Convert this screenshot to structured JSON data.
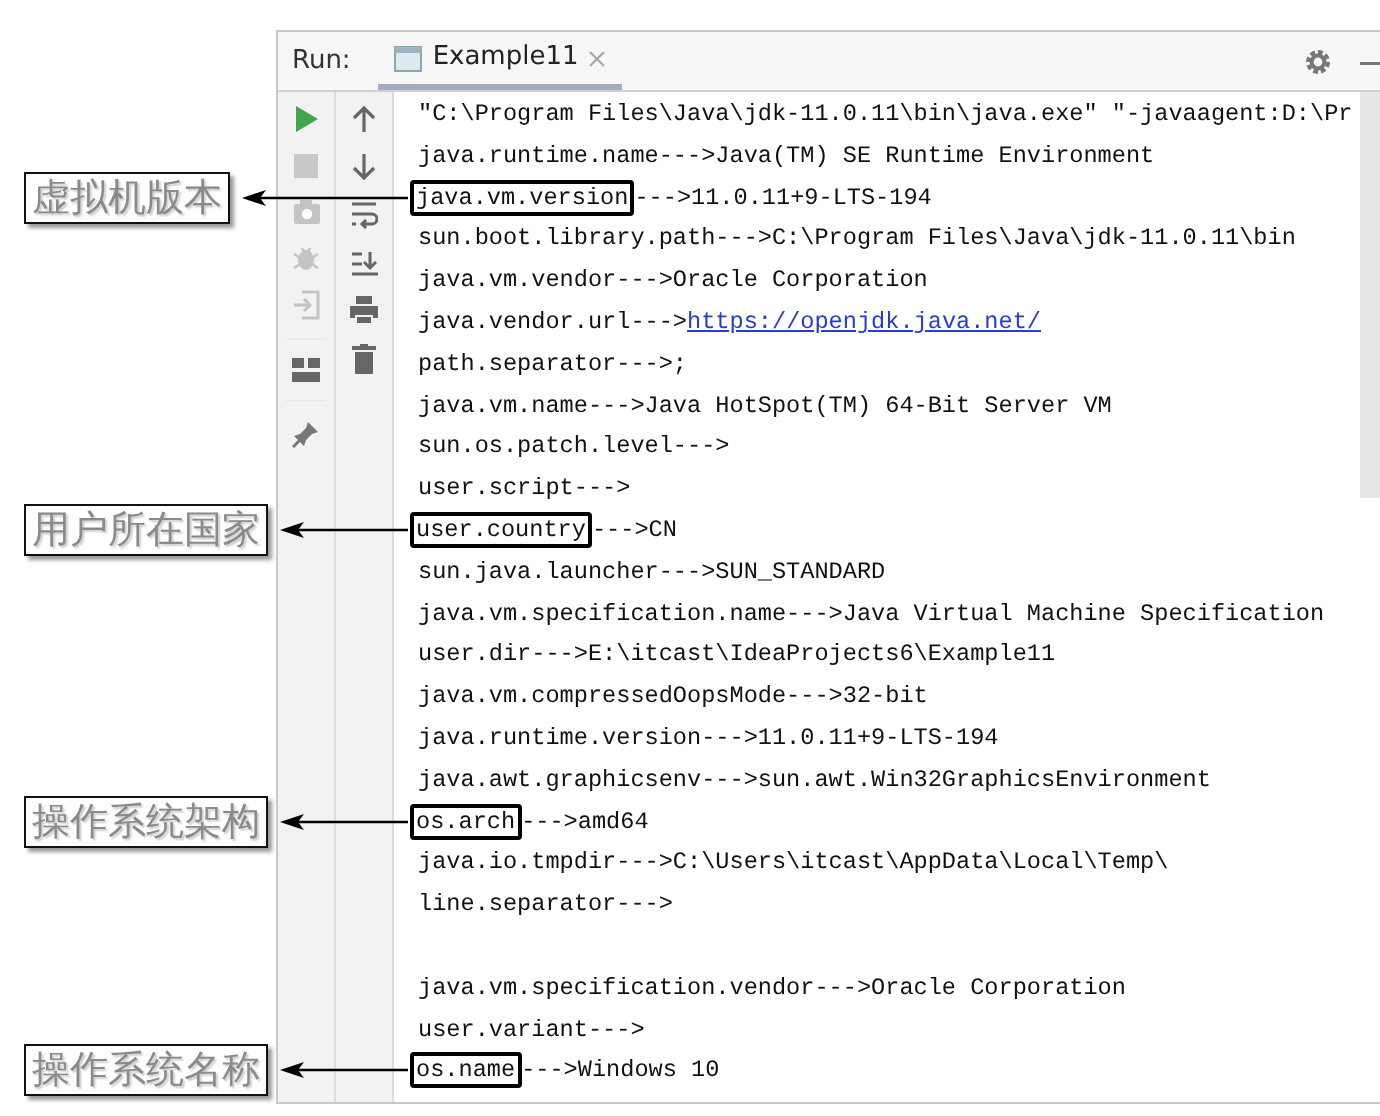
{
  "run_panel": {
    "label": "Run:",
    "tabs": [
      {
        "title": "Example11",
        "selected": true
      }
    ]
  },
  "console": {
    "lines": [
      {
        "kind": "plain",
        "text": "\"C:\\Program Files\\Java\\jdk-11.0.11\\bin\\java.exe\" \"-javaagent:D:\\Pr"
      },
      {
        "kind": "plain",
        "text": "java.runtime.name--->Java(TM) SE Runtime Environment"
      },
      {
        "kind": "boxed",
        "key": "java.vm.version",
        "text": "--->11.0.11+9-LTS-194",
        "callout": "虚拟机版本"
      },
      {
        "kind": "plain",
        "text": "sun.boot.library.path--->C:\\Program Files\\Java\\jdk-11.0.11\\bin"
      },
      {
        "kind": "plain",
        "text": "java.vm.vendor--->Oracle Corporation"
      },
      {
        "kind": "link",
        "text": "java.vendor.url--->",
        "link": "https://openjdk.java.net/"
      },
      {
        "kind": "plain",
        "text": "path.separator--->;"
      },
      {
        "kind": "plain",
        "text": "java.vm.name--->Java HotSpot(TM) 64-Bit Server VM"
      },
      {
        "kind": "plain",
        "text": "sun.os.patch.level--->"
      },
      {
        "kind": "plain",
        "text": "user.script--->"
      },
      {
        "kind": "boxed",
        "key": "user.country",
        "text": "--->CN",
        "callout": "用户所在国家"
      },
      {
        "kind": "plain",
        "text": "sun.java.launcher--->SUN_STANDARD"
      },
      {
        "kind": "plain",
        "text": "java.vm.specification.name--->Java Virtual Machine Specification"
      },
      {
        "kind": "plain",
        "text": "user.dir--->E:\\itcast\\IdeaProjects6\\Example11"
      },
      {
        "kind": "plain",
        "text": "java.vm.compressedOopsMode--->32-bit"
      },
      {
        "kind": "plain",
        "text": "java.runtime.version--->11.0.11+9-LTS-194"
      },
      {
        "kind": "plain",
        "text": "java.awt.graphicsenv--->sun.awt.Win32GraphicsEnvironment"
      },
      {
        "kind": "boxed",
        "key": "os.arch",
        "text": "--->amd64",
        "callout": "操作系统架构"
      },
      {
        "kind": "plain",
        "text": "java.io.tmpdir--->C:\\Users\\itcast\\AppData\\Local\\Temp\\"
      },
      {
        "kind": "plain",
        "text": "line.separator--->"
      },
      {
        "kind": "blank"
      },
      {
        "kind": "plain",
        "text": "java.vm.specification.vendor--->Oracle Corporation"
      },
      {
        "kind": "plain",
        "text": "user.variant--->"
      },
      {
        "kind": "boxed",
        "key": "os.name",
        "text": "--->Windows 10",
        "callout": "操作系统名称"
      }
    ]
  }
}
